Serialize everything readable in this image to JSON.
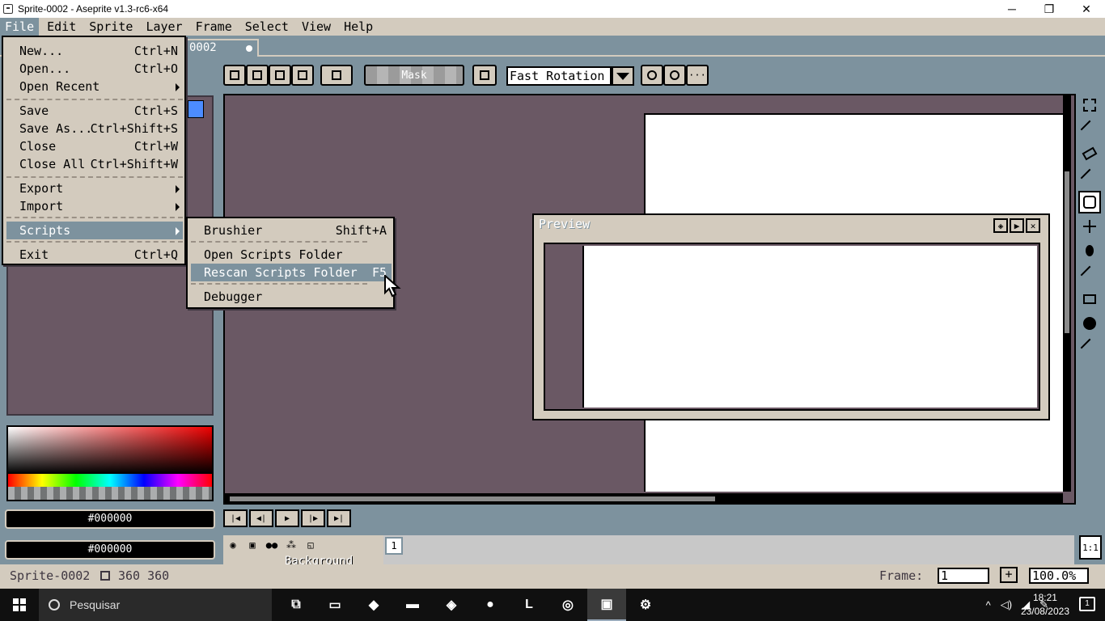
{
  "window": {
    "title": "Sprite-0002 - Aseprite v1.3-rc6-x64",
    "minimize": "─",
    "restore": "❐",
    "close": "✕"
  },
  "menubar": [
    "File",
    "Edit",
    "Sprite",
    "Layer",
    "Frame",
    "Select",
    "View",
    "Help"
  ],
  "tab": {
    "label": "0002"
  },
  "toolbar": {
    "mask_label": "Mask",
    "rotation_algorithm": "Fast Rotation",
    "more": "···"
  },
  "file_menu": {
    "items": [
      {
        "label": "New...",
        "shortcut": "Ctrl+N"
      },
      {
        "label": "Open...",
        "shortcut": "Ctrl+O"
      },
      {
        "label": "Open Recent",
        "shortcut": ""
      },
      {
        "label": "Save",
        "shortcut": "Ctrl+S"
      },
      {
        "label": "Save As...",
        "shortcut": "Ctrl+Shift+S"
      },
      {
        "label": "Close",
        "shortcut": "Ctrl+W"
      },
      {
        "label": "Close All",
        "shortcut": "Ctrl+Shift+W"
      },
      {
        "label": "Export",
        "shortcut": ""
      },
      {
        "label": "Import",
        "shortcut": ""
      },
      {
        "label": "Scripts",
        "shortcut": ""
      },
      {
        "label": "Exit",
        "shortcut": "Ctrl+Q"
      }
    ]
  },
  "scripts_menu": {
    "items": [
      {
        "label": "Brushier",
        "shortcut": "Shift+A"
      },
      {
        "label": "Open Scripts Folder",
        "shortcut": ""
      },
      {
        "label": "Rescan Scripts Folder",
        "shortcut": "F5"
      },
      {
        "label": "Debugger",
        "shortcut": ""
      }
    ]
  },
  "colors": {
    "foreground": "#000000",
    "background": "#000000",
    "palette_selected": "#4c8cff",
    "accent": "#7d929e"
  },
  "preview": {
    "title": "Preview"
  },
  "timeline": {
    "frame_number": "1",
    "layer_name": "Background"
  },
  "status": {
    "sprite_name": "Sprite-0002",
    "size": "360 360",
    "frame_label": "Frame:",
    "frame_value": "1",
    "plus": "+",
    "zoom": "100.0%",
    "one_to_one": "1:1"
  },
  "taskbar": {
    "search_placeholder": "Pesquisar",
    "time": "18:21",
    "date": "23/08/2023",
    "notifications": "1"
  }
}
